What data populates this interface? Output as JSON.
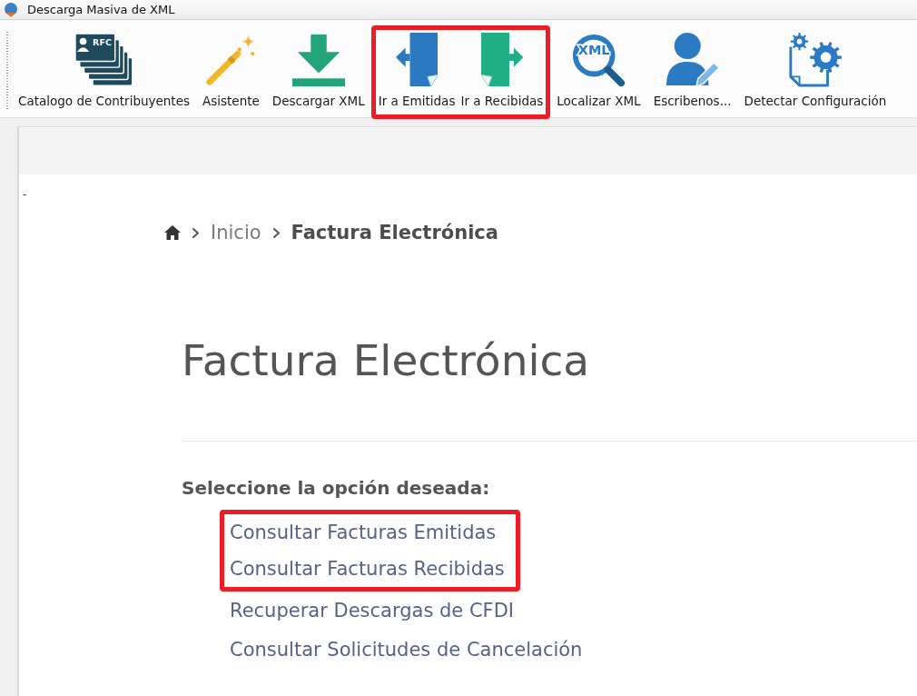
{
  "window": {
    "title": "Descarga Masiva de XML"
  },
  "toolbar": {
    "items": [
      {
        "label": "Catalogo de Contribuyentes",
        "icon_text": "RFC",
        "highlighted": false
      },
      {
        "label": "Asistente",
        "highlighted": false
      },
      {
        "label": "Descargar XML",
        "highlighted": false
      },
      {
        "label": "Ir a Emitidas",
        "highlighted": true
      },
      {
        "label": "Ir a Recibidas",
        "highlighted": true
      },
      {
        "label": "Localizar XML",
        "icon_text": "XML",
        "highlighted": false
      },
      {
        "label": "Escribenos...",
        "highlighted": false
      },
      {
        "label": "Detectar Configuración",
        "highlighted": false
      }
    ]
  },
  "page": {
    "marker": "-",
    "breadcrumb": [
      {
        "label": "Inicio",
        "current": false
      },
      {
        "label": "Factura Electrónica",
        "current": true
      }
    ],
    "heading": "Factura Electrónica",
    "prompt": "Seleccione la opción deseada:",
    "links": [
      {
        "label": "Consultar Facturas Emitidas",
        "highlighted": true
      },
      {
        "label": "Consultar Facturas Recibidas",
        "highlighted": true
      },
      {
        "label": "Recuperar Descargas de CFDI",
        "highlighted": false
      },
      {
        "label": "Consultar Solicitudes de Cancelación",
        "highlighted": false
      }
    ]
  }
}
